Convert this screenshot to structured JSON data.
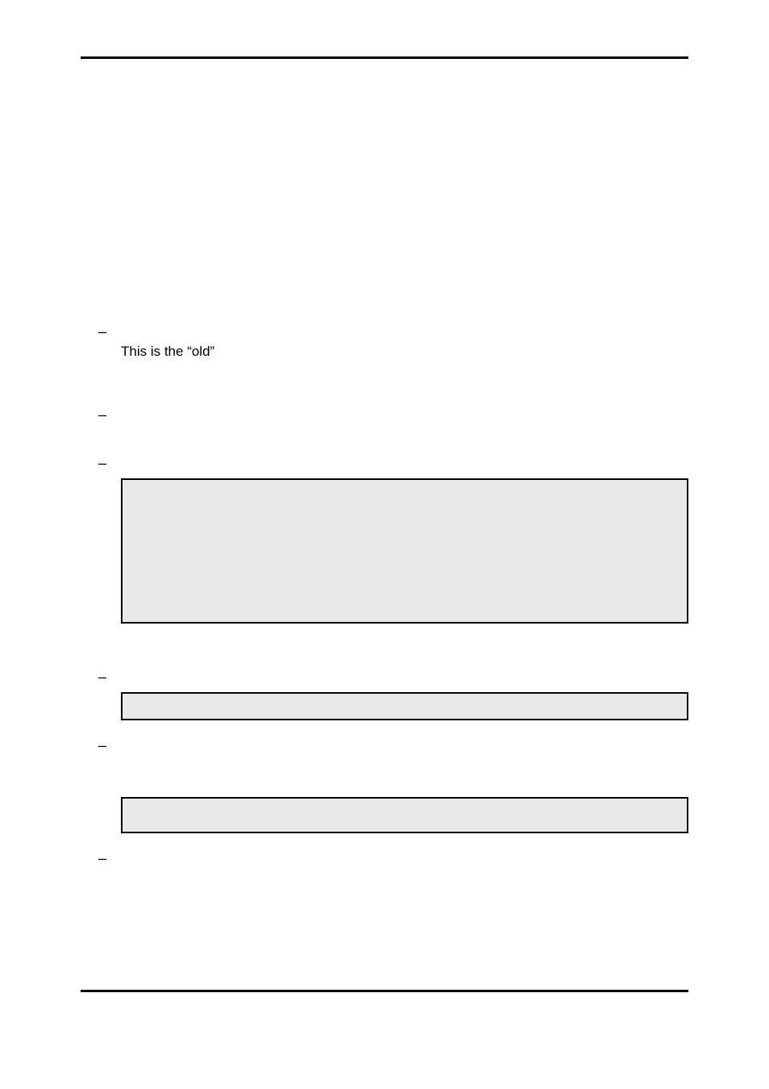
{
  "items": [
    {
      "dash": "–",
      "lines": [
        "This is the “old”"
      ]
    },
    {
      "dash": "–",
      "lines": []
    },
    {
      "dash": "–",
      "lines": []
    },
    {
      "dash": "–",
      "lines": []
    },
    {
      "dash": "–",
      "lines": []
    },
    {
      "dash": "–",
      "lines": []
    }
  ]
}
